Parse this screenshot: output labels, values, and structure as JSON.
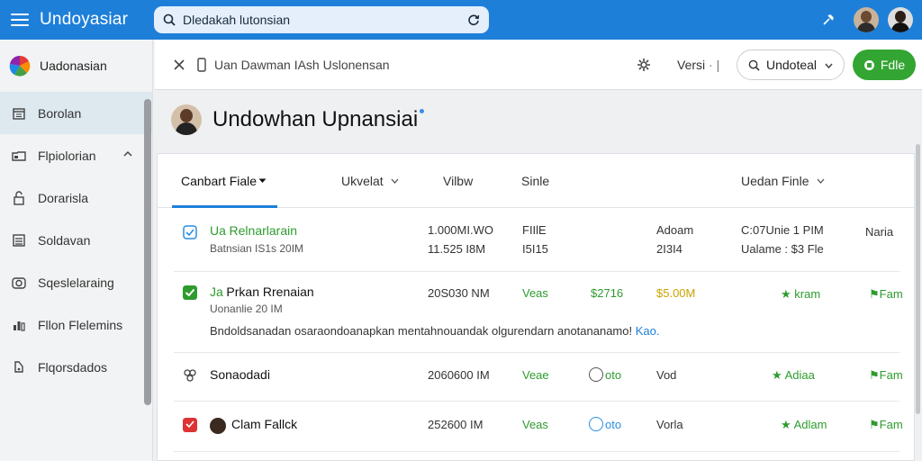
{
  "topbar": {
    "title": "Undoyasiar",
    "search_value": "Dledakah lutonsian"
  },
  "sidebar": {
    "brand": "Uadonasian",
    "items": [
      {
        "label": "Borolan",
        "icon": "calendar-icon",
        "active": true
      },
      {
        "label": "Flpiolorian",
        "icon": "folder-icon",
        "active": false,
        "expandable": true
      },
      {
        "label": "Dorarisla",
        "icon": "lock-icon",
        "active": false
      },
      {
        "label": "Soldavan",
        "icon": "list-icon",
        "active": false
      },
      {
        "label": "Sqeslelaraing",
        "icon": "camera-icon",
        "active": false
      },
      {
        "label": "Fllon Flelemins",
        "icon": "chart-icon",
        "active": false
      },
      {
        "label": "Flqorsdados",
        "icon": "tag-icon",
        "active": false
      }
    ]
  },
  "toolbar": {
    "path": "Uan Dawman IAsh Uslonensan",
    "version_label": "Versi",
    "version_sep": "· |",
    "select_value": "Undoteal",
    "file_button": "Fdle"
  },
  "page": {
    "title": "Undowhan Upnansiai"
  },
  "tabs": [
    {
      "label": "Canbart Fiale",
      "active": true,
      "chevron": true
    },
    {
      "label": "Ukvelat",
      "active": false,
      "chevron": true
    },
    {
      "label": "Vilbw",
      "active": false,
      "chevron": false
    },
    {
      "label": "Sinle",
      "active": false,
      "chevron": false
    },
    {
      "label": "Uedan Finle",
      "active": false,
      "chevron": true
    }
  ],
  "rows": [
    {
      "name_prefix": "Ua",
      "name": "Relnarlarain",
      "sub": "Batnsian IS1s 20IM",
      "col2a": "1.000MI.WO",
      "col2b": "11.525 I8M",
      "col3a": "FIIlE",
      "col3b": "I5I15",
      "col5a": "Adoam",
      "col5b": "2I3I4",
      "col6a": "C:07Unie 1 PIM",
      "col6b": "Ualame : $3 Fle",
      "col7": "Naria"
    },
    {
      "name_prefix": "Ja",
      "name": "Prkan Rrenaian",
      "sub": "Uonanlie 20 IM",
      "col2": "20S030 NM",
      "col3": "Veas",
      "col4": "$2716",
      "col5": "$5.00M",
      "col6": "kram",
      "col7": "Fam",
      "note": "Bndoldsanadan osaraondoanapkan mentahnouandak olgurendarn  anotananamo!",
      "note_link": "Kao."
    },
    {
      "name": "Sonaodadi",
      "col2": "2060600 IM",
      "col3": "Veae",
      "col4": "oto",
      "col5": "Vod",
      "col6": "Adiaa",
      "col7": "Fam"
    },
    {
      "name": "Clam Fallck",
      "col2": "252600 IM",
      "col3": "Veas",
      "col4": "oto",
      "col5": "Vorla",
      "col6": "Adlam",
      "col7": "Fam"
    }
  ],
  "colors": {
    "topbar": "#1e7fd9",
    "accent_green": "#33a532",
    "gold": "#c9a400"
  }
}
